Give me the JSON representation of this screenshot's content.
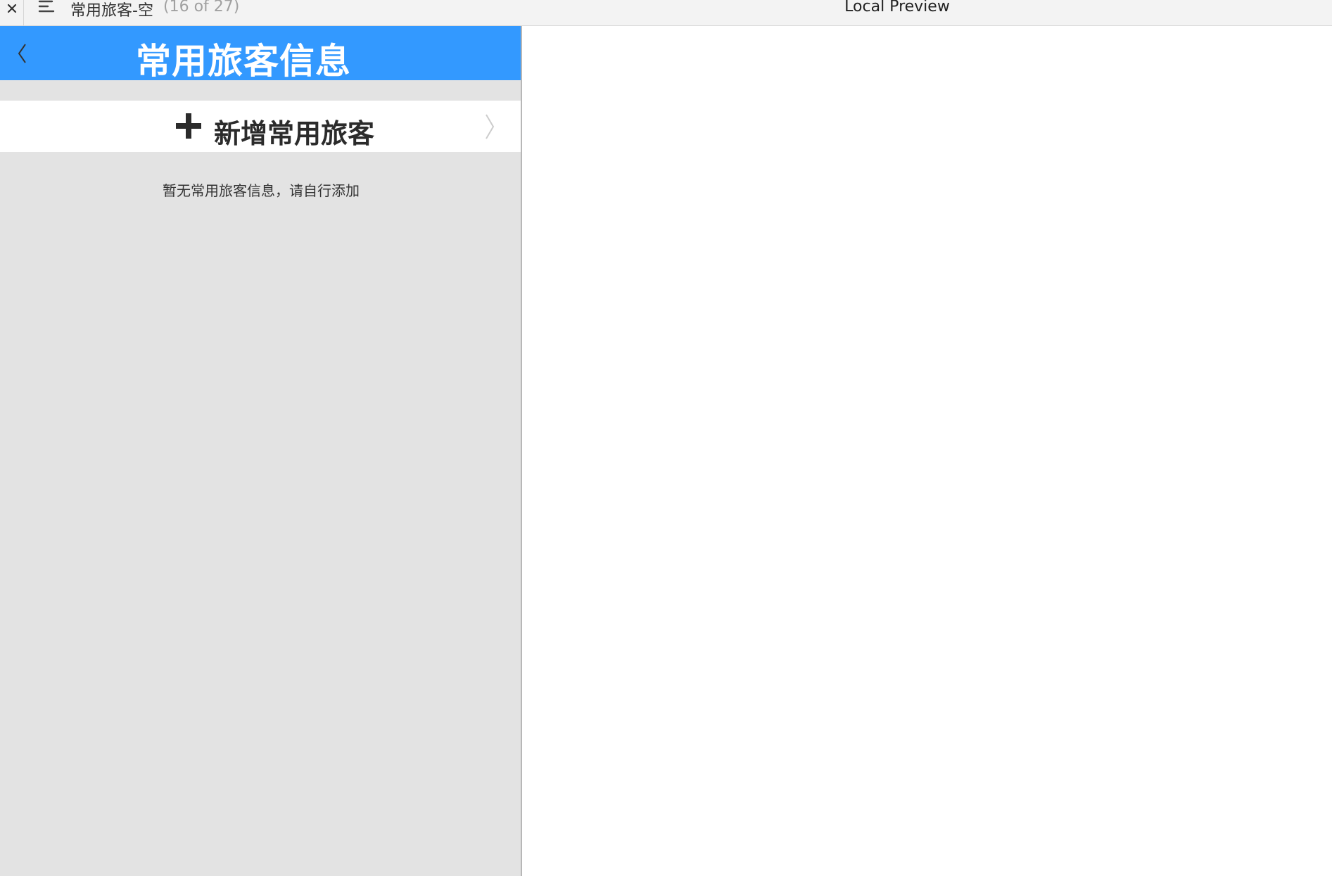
{
  "topbar": {
    "page_name": "常用旅客-空",
    "page_count": "(16 of 27)",
    "preview_title": "Local Preview"
  },
  "nav": {
    "title": "常用旅客信息"
  },
  "add_traveler": {
    "label": "新增常用旅客"
  },
  "empty_state": {
    "message": "暂无常用旅客信息，请自行添加"
  },
  "colors": {
    "nav_blue": "#3399ff",
    "panel_gray": "#e3e3e3",
    "topbar_gray": "#f3f3f3"
  },
  "icons": {
    "close": "close-icon",
    "menu": "menu-icon",
    "back": "back-chevron-icon",
    "plus": "plus-icon",
    "forward": "chevron-right-icon"
  }
}
